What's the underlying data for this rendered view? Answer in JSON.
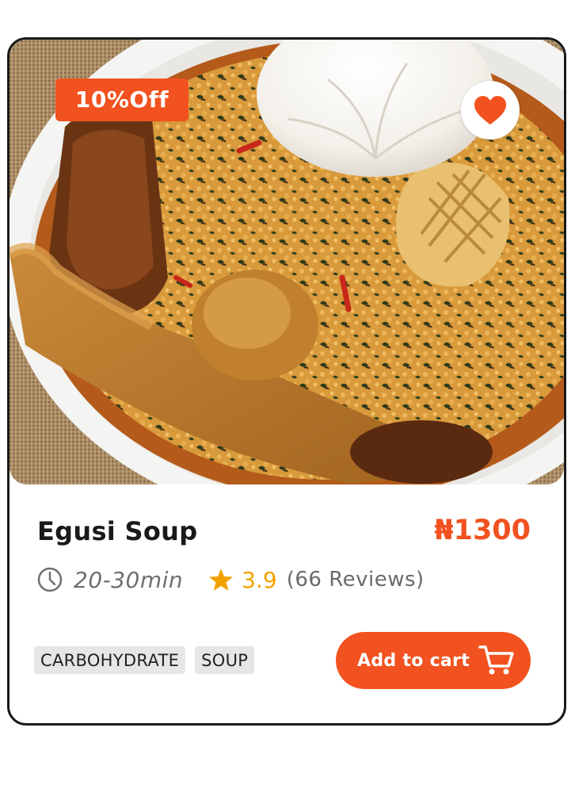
{
  "product": {
    "discount_badge": "10%Off",
    "name": "Egusi Soup",
    "price": "₦1300",
    "prep_time": "20-30min",
    "rating": "3.9",
    "reviews": "(66 Reviews)",
    "tags": [
      "CARBOHYDRATE",
      "SOUP"
    ],
    "add_to_cart_label": "Add to cart",
    "favorited": true
  },
  "icons": {
    "favorite": "heart-icon",
    "time": "clock-icon",
    "rating": "star-icon",
    "cart": "shopping-cart-icon"
  },
  "colors": {
    "accent": "#f1521f",
    "rating": "#f2a200",
    "card_border": "#1a1a1a",
    "tag_bg": "#e6e6e6"
  }
}
